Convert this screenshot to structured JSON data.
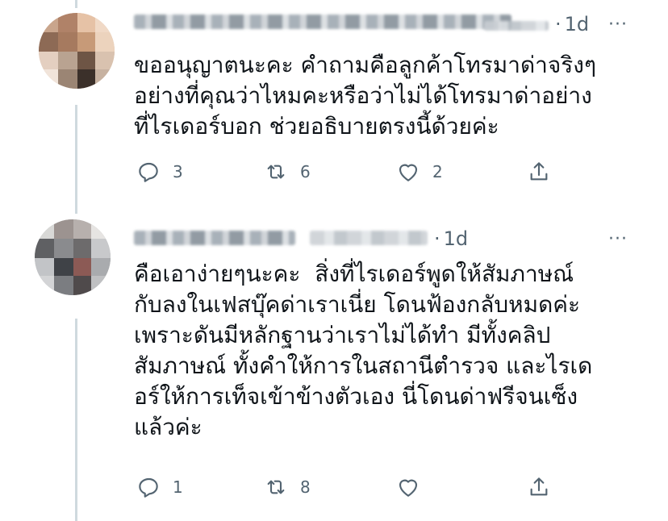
{
  "tweets": [
    {
      "time": "1d",
      "separator": "·",
      "more": "···",
      "text": "ขออนุญาตนะคะ คำถามคือลูกค้าโทรมาด่าจริงๆ\nอย่างที่คุณว่าไหมคะหรือว่าไม่ได้โทรมาด่าอย่าง\nที่ไรเดอร์บอก ช่วยอธิบายตรงนี้ด้วยค่ะ",
      "replies": "3",
      "retweets": "6",
      "likes": "2"
    },
    {
      "time": "1d",
      "separator": "·",
      "more": "···",
      "text": "คือเอาง่ายๆนะคะ  สิ่งที่ไรเดอร์พูดให้สัมภาษณ์\nกับลงในเฟสบุ๊คด่าเราเนี่ย โดนฟ้องกลับหมดค่ะ\nเพราะดันมีหลักฐานว่าเราไม่ได้ทำ มีทั้งคลิป\nสัมภาษณ์ ทั้งคำให้การในสถานีตำรวจ และไรเด\nอร์ให้การเท็จเข้าข้างตัวเอง นี่โดนด่าฟรีจนเซ็ง\nแล้วค่ะ",
      "replies": "1",
      "retweets": "8",
      "likes": ""
    }
  ],
  "icons": {
    "reply": "reply-icon",
    "retweet": "retweet-icon",
    "like": "like-icon",
    "share": "share-icon",
    "more": "more-icon"
  },
  "colors": {
    "text": "#0f1419",
    "secondary": "#536471",
    "thread_line": "#cfd9de"
  }
}
